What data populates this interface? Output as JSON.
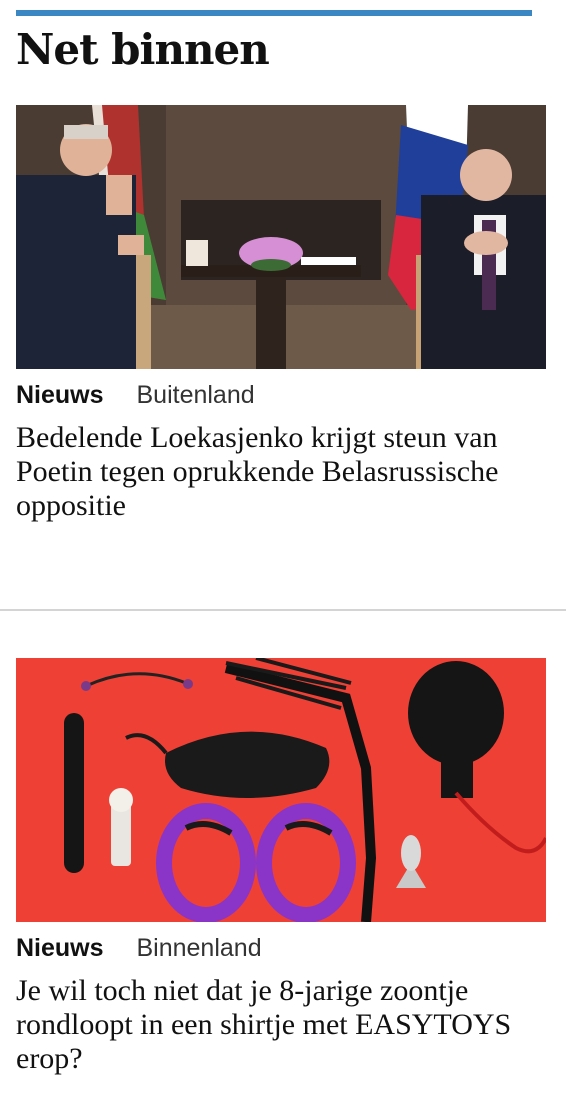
{
  "section": {
    "title": "Net binnen",
    "accent_color": "#3a87c3"
  },
  "articles": [
    {
      "image_alt": "Two men seated in armchairs between Belarusian and Russian flags",
      "category": "Nieuws",
      "subcategory": "Buitenland",
      "headline": "Bedelende Loekasjenko krijgt steun van Poetin tegen oprukkende Belasrussische oppositie"
    },
    {
      "image_alt": "Black accessories arranged on a red background",
      "category": "Nieuws",
      "subcategory": "Binnenland",
      "headline": "Je wil toch niet dat je 8-jarige zoontje rondloopt in een shirtje met EASYTOYS erop?"
    }
  ]
}
